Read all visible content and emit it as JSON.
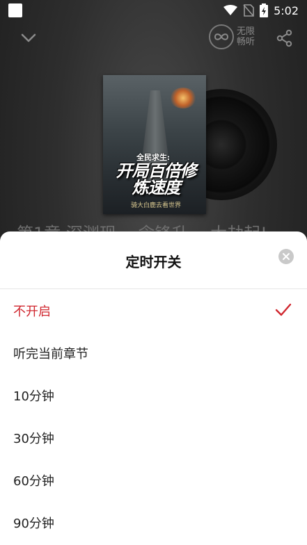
{
  "status_bar": {
    "time": "5:02"
  },
  "top_bar": {
    "infinite_badge_label": "无限畅听"
  },
  "cover": {
    "subtitle": "全民求生:",
    "title": "开局百倍修炼速度",
    "author": "骑大白鹿去看世界"
  },
  "chapter_title": "第1章 深渊现 一念锋升 一大劫起!",
  "sheet": {
    "title": "定时开关",
    "options": [
      {
        "label": "不开启",
        "selected": true
      },
      {
        "label": "听完当前章节",
        "selected": false
      },
      {
        "label": "10分钟",
        "selected": false
      },
      {
        "label": "30分钟",
        "selected": false
      },
      {
        "label": "60分钟",
        "selected": false
      },
      {
        "label": "90分钟",
        "selected": false
      }
    ]
  },
  "colors": {
    "accent": "#d0262e",
    "sheet_bg": "#ffffff",
    "player_bg": "#2e2e2e"
  },
  "icons": [
    "square-icon",
    "wifi-icon",
    "no-sim-icon",
    "battery-charging-icon",
    "chevron-down-icon",
    "infinity-icon",
    "share-icon",
    "close-icon",
    "check-icon"
  ]
}
